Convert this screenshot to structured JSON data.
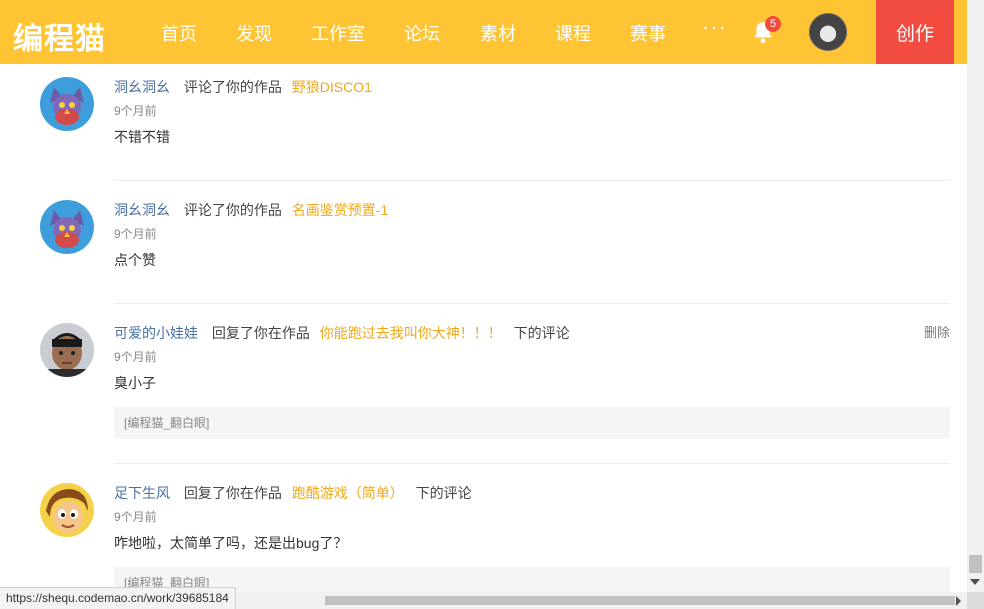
{
  "nav": {
    "logo": "编程猫",
    "items": [
      "首页",
      "发现",
      "工作室",
      "论坛",
      "素材",
      "课程",
      "赛事"
    ],
    "more": "···",
    "badge_count": "5",
    "create_label": "创作",
    "colors": {
      "bar": "#fec433",
      "create": "#f24b3f"
    }
  },
  "feed": [
    {
      "user": "洞幺洞幺",
      "action": "评论了你的作品",
      "work": "野狼DISCO1",
      "suffix": "",
      "time": "9个月前",
      "text": "不错不错",
      "delete": "",
      "quote": ""
    },
    {
      "user": "洞幺洞幺",
      "action": "评论了你的作品",
      "work": "名画鉴赏预置-1",
      "suffix": "",
      "time": "9个月前",
      "text": "点个赞",
      "delete": "",
      "quote": ""
    },
    {
      "user": "可爱的小娃娃",
      "action": "回复了你在作品",
      "work": "你能跑过去我叫你大神！！！",
      "suffix": "下的评论",
      "time": "9个月前",
      "text": "臭小子",
      "delete": "删除",
      "quote": "[编程猫_翻白眼]"
    },
    {
      "user": "足下生风",
      "action": "回复了你在作品",
      "work": "跑酷游戏（简单）",
      "suffix": "下的评论",
      "time": "9个月前",
      "text": "咋地啦，太简单了吗，还是出bug了？",
      "delete": "",
      "quote": "[编程猫_翻白眼]"
    }
  ],
  "status_url": "https://shequ.codemao.cn/work/39685184"
}
